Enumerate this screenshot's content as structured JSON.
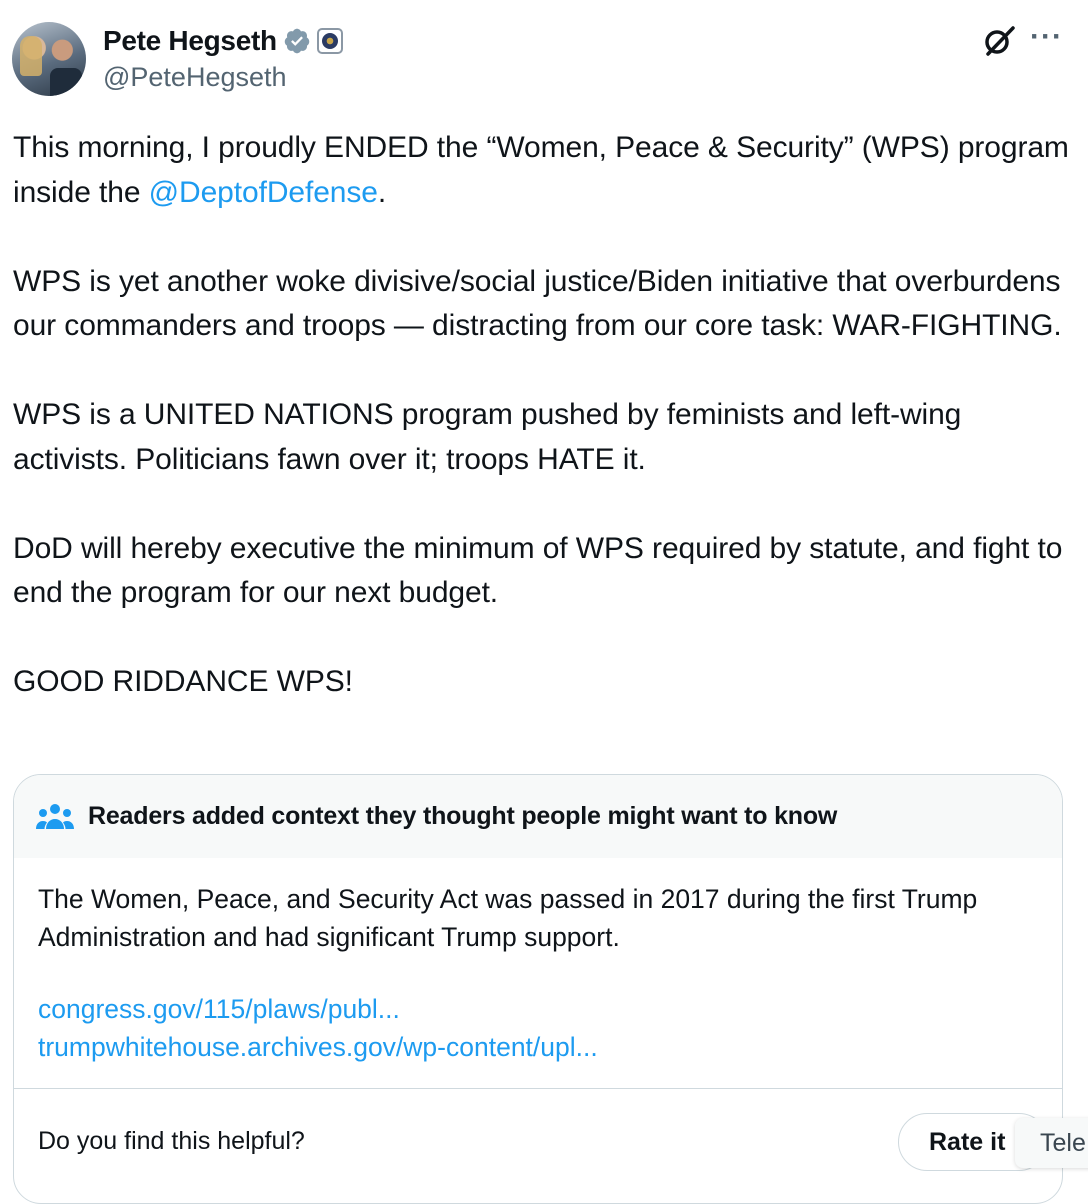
{
  "author": {
    "display_name": "Pete Hegseth",
    "handle": "@PeteHegseth"
  },
  "post": {
    "p1_text": "This morning, I proudly ENDED the “Women, Peace & Security” (WPS) program inside the ",
    "p1_mention": "@DeptofDefense",
    "p1_end": ".",
    "p2": "WPS is yet another woke divisive/social justice/Biden initiative that overburdens our commanders and troops — distracting from our core task: WAR-FIGHTING.",
    "p3": "WPS is a UNITED NATIONS program pushed by feminists and left-wing activists. Politicians fawn over it; troops HATE it.",
    "p4": "DoD will hereby executive the minimum of WPS required by statute, and fight to end the program for our next budget.",
    "p5": "GOOD RIDDANCE WPS!"
  },
  "community_note": {
    "title": "Readers added context they thought people might want to know",
    "text": "The Women, Peace, and Security Act was passed in 2017 during the first Trump Administration and had significant Trump support.",
    "links": [
      "congress.gov/115/plaws/publ...",
      "trumpwhitehouse.archives.gov/wp-content/upl..."
    ],
    "helpful_question": "Do you find this helpful?",
    "rate_label": "Rate it"
  },
  "overlay": {
    "tele_label": "Tele"
  },
  "colors": {
    "link": "#1d9bf0",
    "text": "#0f1419",
    "secondary": "#536471",
    "verified": "#829aab"
  },
  "icons": [
    "avatar",
    "verified-icon",
    "affiliation-badge-icon",
    "grok-icon",
    "more-icon",
    "people-icon"
  ]
}
